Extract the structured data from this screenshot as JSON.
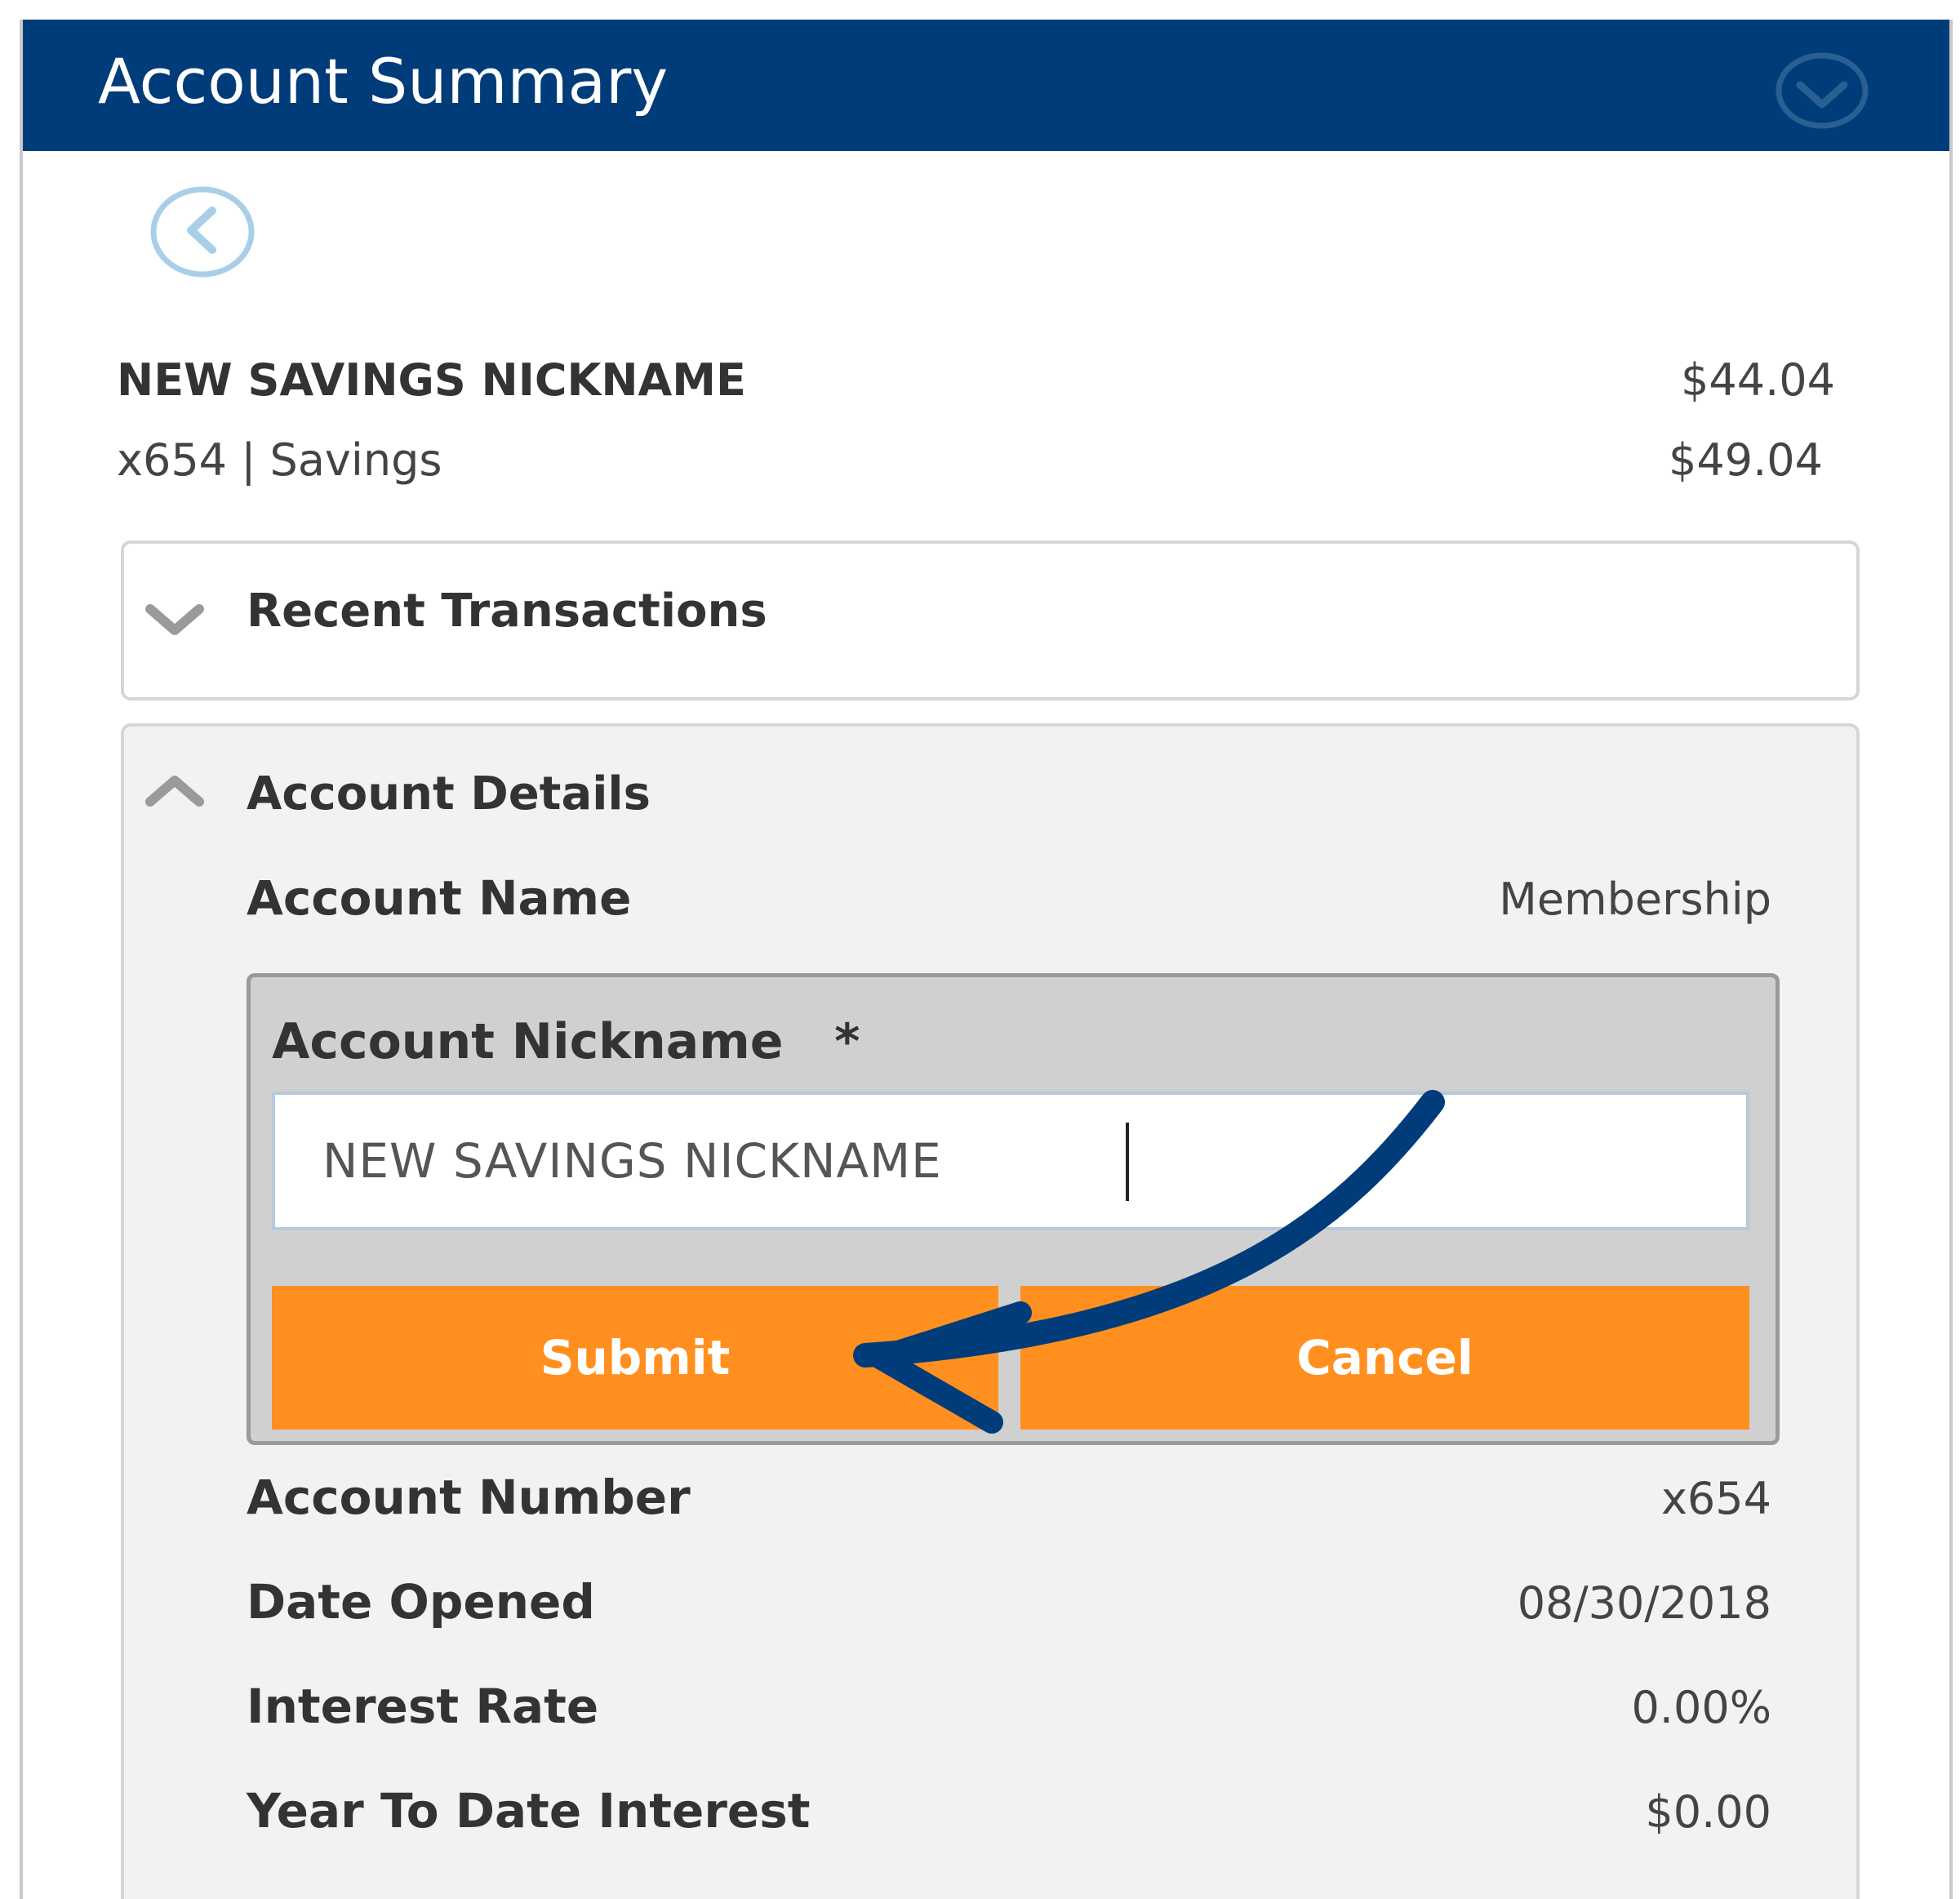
{
  "header": {
    "title": "Account Summary",
    "collapse_icon": "chevron-down-circle-icon"
  },
  "navigation": {
    "back_icon": "chevron-left-circle-icon"
  },
  "account": {
    "title": "NEW SAVINGS NICKNAME",
    "balance_primary": "$44.04",
    "subtitle": "x654 | Savings",
    "balance_secondary": "$49.04"
  },
  "sections": {
    "recent_transactions": {
      "label": "Recent Transactions",
      "state_icon": "chevron-down-icon"
    },
    "account_details": {
      "label": "Account Details",
      "state_icon": "chevron-up-icon"
    }
  },
  "details": {
    "account_name": {
      "label": "Account Name",
      "value": "Membership"
    },
    "nickname_form": {
      "label": "Account Nickname",
      "required_marker": "*",
      "input_value": "NEW SAVINGS NICKNAME",
      "submit_label": "Submit",
      "cancel_label": "Cancel"
    },
    "account_number": {
      "label": "Account Number",
      "value": "x654"
    },
    "date_opened": {
      "label": "Date Opened",
      "value": "08/30/2018"
    },
    "interest_rate": {
      "label": "Interest Rate",
      "value": "0.00%"
    },
    "ytd_interest": {
      "label": "Year To Date Interest",
      "value": "$0.00"
    }
  },
  "colors": {
    "header_bg": "#003c7a",
    "button_bg": "#ff9020",
    "annotation_arrow": "#003c7a"
  },
  "annotation": {
    "arrow_icon": "curved-arrow-icon"
  }
}
